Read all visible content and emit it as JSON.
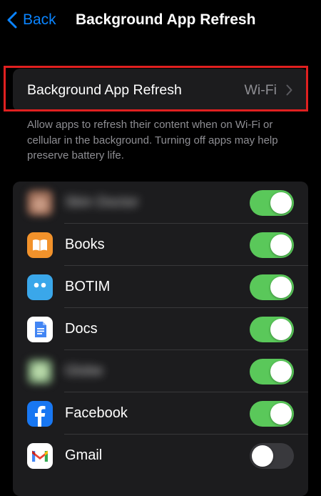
{
  "nav": {
    "back_label": "Back",
    "title": "Background App Refresh"
  },
  "setting": {
    "label": "Background App Refresh",
    "value": "Wi-Fi"
  },
  "footnote": "Allow apps to refresh their content when on Wi-Fi or cellular in the background. Turning off apps may help preserve battery life.",
  "apps": [
    {
      "name": "Skin Doctor",
      "icon": "blurred-app-icon",
      "enabled": true,
      "blurred": true
    },
    {
      "name": "Books",
      "icon": "books-icon",
      "enabled": true,
      "blurred": false
    },
    {
      "name": "BOTIM",
      "icon": "botim-icon",
      "enabled": true,
      "blurred": false
    },
    {
      "name": "Docs",
      "icon": "docs-icon",
      "enabled": true,
      "blurred": false
    },
    {
      "name": "Globe",
      "icon": "blurred-app-icon",
      "enabled": true,
      "blurred": true
    },
    {
      "name": "Facebook",
      "icon": "facebook-icon",
      "enabled": true,
      "blurred": false
    },
    {
      "name": "Gmail",
      "icon": "gmail-icon",
      "enabled": false,
      "blurred": false
    }
  ],
  "colors": {
    "accent": "#0a84ff",
    "toggle_on": "#5ac85a",
    "toggle_off": "#39393d",
    "highlight": "#e02020",
    "cell_background": "#1c1c1e",
    "secondary_text": "#8e8e93"
  }
}
